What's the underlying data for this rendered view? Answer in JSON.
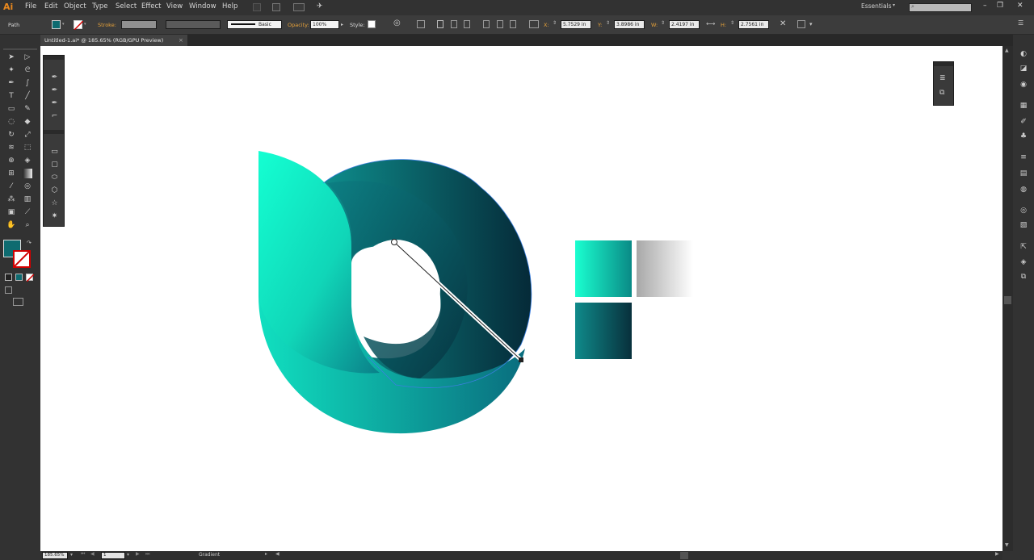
{
  "app": {
    "logo": "Ai"
  },
  "menubar": {
    "items": [
      "File",
      "Edit",
      "Object",
      "Type",
      "Select",
      "Effect",
      "View",
      "Window",
      "Help"
    ],
    "workspace": "Essentials",
    "window_controls": [
      "–",
      "❐",
      "✕"
    ]
  },
  "controlbar": {
    "selection_label": "Path",
    "stroke_label": "Stroke:",
    "brush_label": "Basic",
    "opacity_label": "Opacity:",
    "opacity_value": "100%",
    "style_label": "Style:",
    "x_label": "X:",
    "x_value": "5.7529 in",
    "y_label": "Y:",
    "y_value": "3.8986 in",
    "w_label": "W:",
    "w_value": "2.4197 in",
    "h_label": "H:",
    "h_value": "2.7561 in",
    "colors": {
      "fill": "#0e6b70",
      "accent": "#e8a33a"
    }
  },
  "document": {
    "tab_title": "Untitled-1.ai* @ 185.65% (RGB/GPU Preview)",
    "tab_close": "×"
  },
  "statusbar": {
    "zoom": "185.65%",
    "artboard": "1",
    "tool_name": "Gradient"
  },
  "artwork": {
    "swatches": [
      {
        "name": "cyan-gradient",
        "from": "#1affd0",
        "to": "#0a8a86"
      },
      {
        "name": "gray-gradient",
        "from": "#a8a8a8",
        "to": "#ffffff"
      },
      {
        "name": "teal-gradient",
        "from": "#0f8a8a",
        "to": "#08303c"
      }
    ],
    "logo_colors": {
      "light": "#12ffcc",
      "mid": "#0d8f8e",
      "dark": "#072b3a"
    }
  },
  "icons": {
    "tools": [
      "selection-icon",
      "direct-selection-icon",
      "magic-wand-icon",
      "lasso-icon",
      "pen-icon",
      "curvature-icon",
      "type-icon",
      "line-icon",
      "rectangle-icon",
      "paintbrush-icon",
      "shaper-icon",
      "eraser-icon",
      "rotate-icon",
      "scale-icon",
      "width-icon",
      "free-transform-icon",
      "shape-builder-icon",
      "perspective-icon",
      "mesh-icon",
      "gradient-icon",
      "eyedropper-icon",
      "blend-icon",
      "symbol-sprayer-icon",
      "column-graph-icon",
      "artboard-icon",
      "slice-icon",
      "hand-icon",
      "zoom-icon"
    ]
  }
}
